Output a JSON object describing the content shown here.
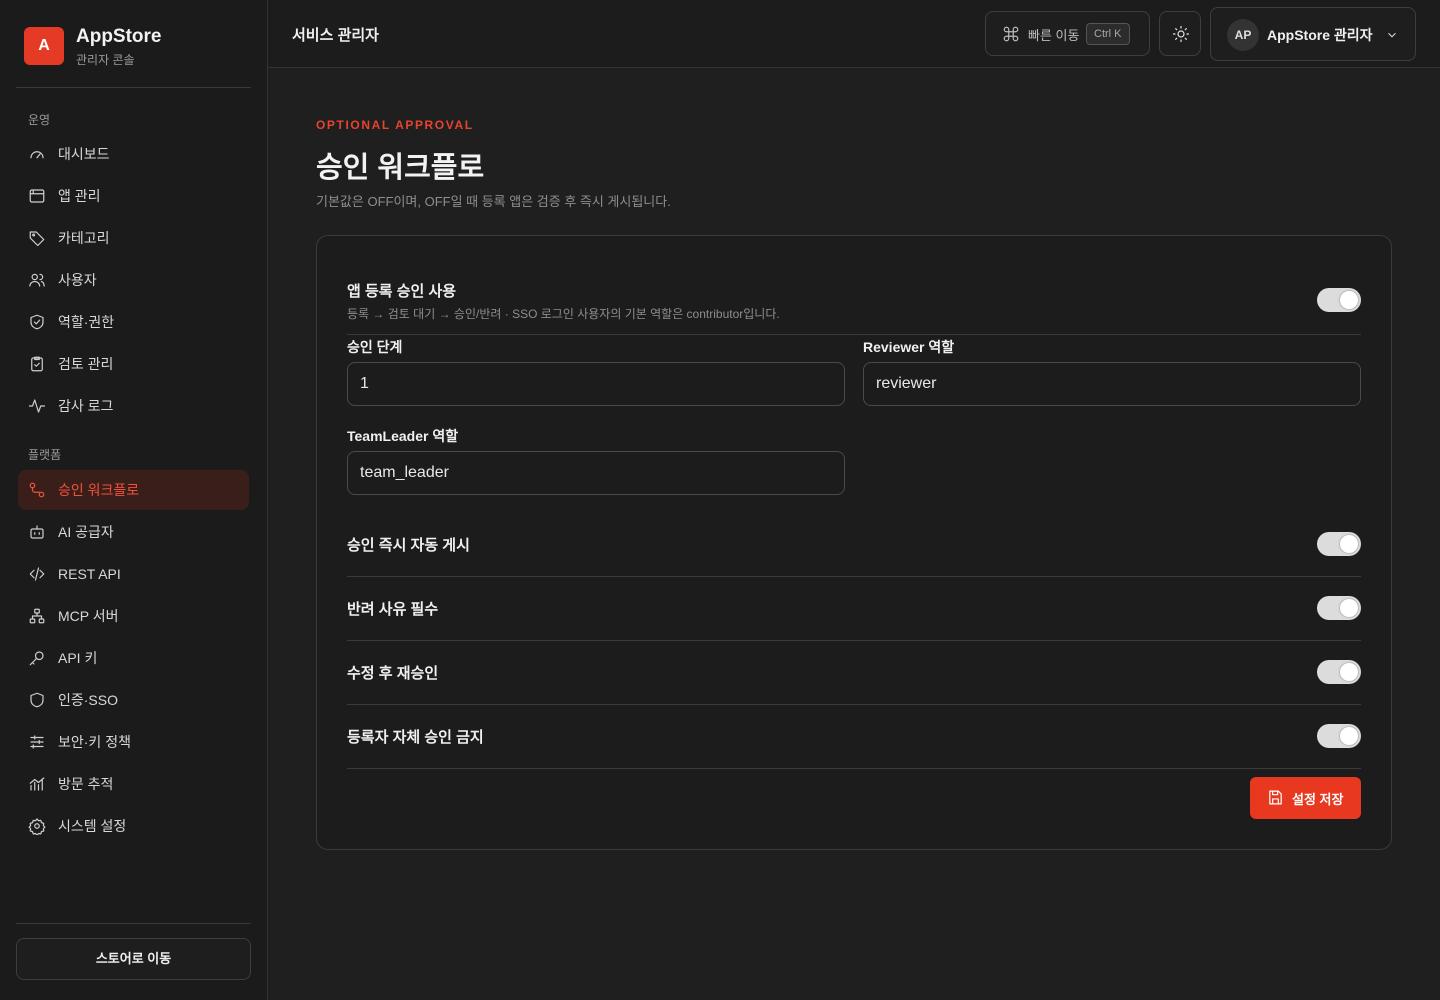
{
  "brand": {
    "logo_letter": "A",
    "name": "AppStore",
    "subtitle": "관리자 콘솔"
  },
  "sidebar": {
    "sections": [
      {
        "title": "운영",
        "items": [
          {
            "label": "대시보드",
            "icon": "gauge-icon"
          },
          {
            "label": "앱 관리",
            "icon": "window-icon"
          },
          {
            "label": "카테고리",
            "icon": "tag-icon"
          },
          {
            "label": "사용자",
            "icon": "users-icon"
          },
          {
            "label": "역할·권한",
            "icon": "shield-check-icon"
          },
          {
            "label": "검토 관리",
            "icon": "clipboard-check-icon"
          },
          {
            "label": "감사 로그",
            "icon": "activity-icon"
          }
        ]
      },
      {
        "title": "플랫폼",
        "items": [
          {
            "label": "승인 워크플로",
            "icon": "workflow-icon",
            "active": true
          },
          {
            "label": "AI 공급자",
            "icon": "bot-icon"
          },
          {
            "label": "REST API",
            "icon": "code-icon"
          },
          {
            "label": "MCP 서버",
            "icon": "network-icon"
          },
          {
            "label": "API 키",
            "icon": "key-icon"
          },
          {
            "label": "인증·SSO",
            "icon": "shield-icon"
          },
          {
            "label": "보안·키 정책",
            "icon": "sliders-icon"
          },
          {
            "label": "방문 추적",
            "icon": "chart-icon"
          },
          {
            "label": "시스템 설정",
            "icon": "gear-icon"
          }
        ]
      }
    ],
    "store_button": "스토어로 이동"
  },
  "header": {
    "title": "서비스 관리자",
    "quick_nav_label": "빠른 이동",
    "quick_nav_shortcut": "Ctrl K",
    "user_initials": "AP",
    "user_name": "AppStore 관리자"
  },
  "page": {
    "eyebrow": "OPTIONAL APPROVAL",
    "title": "승인 워크플로",
    "description": "기본값은 OFF이며, OFF일 때 등록 앱은 검증 후 즉시 게시됩니다."
  },
  "card": {
    "main_setting": {
      "title": "앱 등록 승인 사용",
      "subtitle": "등록 → 검토 대기 → 승인/반려 · SSO 로그인 사용자의 기본 역할은 contributor입니다.",
      "enabled": true
    },
    "fields": {
      "steps": {
        "label": "승인 단계",
        "value": "1"
      },
      "reviewer_role": {
        "label": "Reviewer 역할",
        "value": "reviewer"
      },
      "team_leader_role": {
        "label": "TeamLeader 역할",
        "value": "team_leader"
      }
    },
    "toggles": [
      {
        "label": "승인 즉시 자동 게시",
        "enabled": true
      },
      {
        "label": "반려 사유 필수",
        "enabled": true
      },
      {
        "label": "수정 후 재승인",
        "enabled": true
      },
      {
        "label": "등록자 자체 승인 금지",
        "enabled": true
      }
    ],
    "save_button": "설정 저장"
  },
  "colors": {
    "accent": "#e8381f",
    "background": "#1f1f1f",
    "sidebar": "#1b1b1b",
    "active_nav_bg": "#3a1e1a",
    "toggle_on": "#dcdcdc"
  }
}
